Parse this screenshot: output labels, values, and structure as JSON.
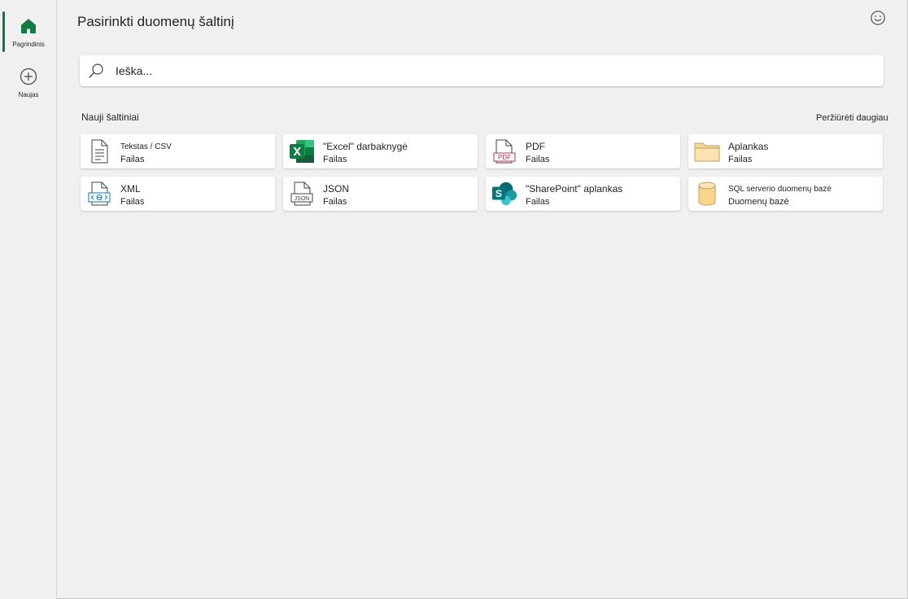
{
  "rail": {
    "home_label": "Pagrindinis",
    "new_label": "Naujas",
    "accent": "#107c41"
  },
  "header": {
    "title": "Pasirinkti duomenų šaltinį"
  },
  "search": {
    "placeholder": "Ieška..."
  },
  "section": {
    "title": "Nauji šaltiniai",
    "see_more": "Peržiūrėti daugiau"
  },
  "sources": [
    {
      "name": "Tekstas / CSV",
      "type": "Failas",
      "icon": "text-file-icon"
    },
    {
      "name": "\"Excel\" darbaknygė",
      "type": "Failas",
      "icon": "excel-icon"
    },
    {
      "name": "PDF",
      "type": "Failas",
      "icon": "pdf-icon"
    },
    {
      "name": "Aplankas",
      "type": "Failas",
      "icon": "folder-icon"
    },
    {
      "name": "XML",
      "type": "Failas",
      "icon": "xml-file-icon"
    },
    {
      "name": "JSON",
      "type": "Failas",
      "icon": "json-file-icon"
    },
    {
      "name": "\"SharePoint\" aplankas",
      "type": "Failas",
      "icon": "sharepoint-icon"
    },
    {
      "name": "SQL serverio duomenų bazė",
      "type": "Duomenų bazė",
      "icon": "database-icon"
    }
  ]
}
